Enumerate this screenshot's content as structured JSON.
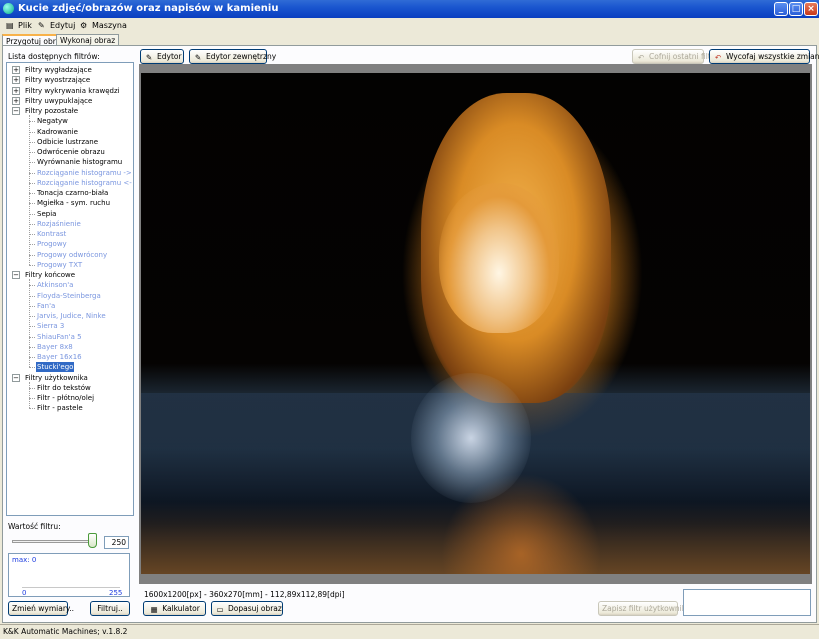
{
  "window": {
    "title": "Kucie zdjęć/obrazów oraz napisów w kamieniu",
    "minimize": "_",
    "maximize": "□",
    "close": "×"
  },
  "menu": [
    {
      "label": "Plik",
      "icon": "document-icon"
    },
    {
      "label": "Edytuj",
      "icon": "pencil-icon"
    },
    {
      "label": "Maszyna",
      "icon": "machine-icon"
    }
  ],
  "tabs": [
    {
      "label": "Przygotuj obraz",
      "active": true
    },
    {
      "label": "Wykonaj obraz",
      "active": false
    }
  ],
  "left_panel": {
    "filters_label": "Lista dostępnych filtrów:",
    "tree": [
      {
        "label": "Filtry wygładzające",
        "type": "group",
        "expander": "+"
      },
      {
        "label": "Filtry wyostrzające",
        "type": "group",
        "expander": "+"
      },
      {
        "label": "Filtry wykrywania krawędzi",
        "type": "group",
        "expander": "+"
      },
      {
        "label": "Filtry uwypuklające",
        "type": "group",
        "expander": "+"
      },
      {
        "label": "Filtry pozostałe",
        "type": "group",
        "expander": "−"
      },
      {
        "label": "Negatyw",
        "type": "leaf"
      },
      {
        "label": "Kadrowanie",
        "type": "leaf"
      },
      {
        "label": "Odbicie lustrzane",
        "type": "leaf"
      },
      {
        "label": "Odwrócenie obrazu",
        "type": "leaf"
      },
      {
        "label": "Wyrównanie histogramu",
        "type": "leaf"
      },
      {
        "label": "Rozciąganie histogramu ->",
        "type": "leaf",
        "disabled": true
      },
      {
        "label": "Rozciąganie histogramu <-",
        "type": "leaf",
        "disabled": true
      },
      {
        "label": "Tonacja czarno-biała",
        "type": "leaf"
      },
      {
        "label": "Mgiełka - sym. ruchu",
        "type": "leaf"
      },
      {
        "label": "Sepia",
        "type": "leaf"
      },
      {
        "label": "Rozjaśnienie",
        "type": "leaf",
        "disabled": true
      },
      {
        "label": "Kontrast",
        "type": "leaf",
        "disabled": true
      },
      {
        "label": "Progowy",
        "type": "leaf",
        "disabled": true
      },
      {
        "label": "Progowy odwrócony",
        "type": "leaf",
        "disabled": true
      },
      {
        "label": "Progowy TXT",
        "type": "leaf",
        "disabled": true
      },
      {
        "label": "Filtry końcowe",
        "type": "group",
        "expander": "−"
      },
      {
        "label": "Atkinson'a",
        "type": "leaf",
        "disabled": true
      },
      {
        "label": "Floyda-Steinberga",
        "type": "leaf",
        "disabled": true
      },
      {
        "label": "Fan'a",
        "type": "leaf",
        "disabled": true
      },
      {
        "label": "Jarvis, Judice, Ninke",
        "type": "leaf",
        "disabled": true
      },
      {
        "label": "Sierra 3",
        "type": "leaf",
        "disabled": true
      },
      {
        "label": "ShiauFan'a 5",
        "type": "leaf",
        "disabled": true
      },
      {
        "label": "Bayer 8x8",
        "type": "leaf",
        "disabled": true
      },
      {
        "label": "Bayer 16x16",
        "type": "leaf",
        "disabled": true
      },
      {
        "label": "Stucki'ego",
        "type": "leaf",
        "selected": true
      },
      {
        "label": "Filtry użytkownika",
        "type": "group",
        "expander": "−"
      },
      {
        "label": "Filtr do tekstów",
        "type": "leaf"
      },
      {
        "label": "Filtr - płótno/olej",
        "type": "leaf"
      },
      {
        "label": "Filtr - pastele",
        "type": "leaf"
      }
    ],
    "value_label": "Wartość filtru:",
    "value": "250",
    "slider_fraction": 0.98,
    "histogram": {
      "max_label": "max: 0",
      "min_tick": "0",
      "max_tick": "255"
    },
    "resize_button": "Zmień wymiary..",
    "filter_button": "Filtruj.."
  },
  "toolbar": {
    "editor": "Edytor",
    "external_editor": "Edytor zewnętrzny",
    "undo_last": "Cofnij ostatni filtr",
    "undo_all": "Wycofaj wszystkie zmiany"
  },
  "bottom": {
    "info": "1600x1200[px] - 360x270[mm] - 112,89x112,89[dpi]",
    "calculator": "Kalkulator",
    "fit_image": "Dopasuj obraz",
    "save_user_filter": "Zapisz filtr użytkownika"
  },
  "status": "K&K Automatic Machines; v.1.8.2"
}
